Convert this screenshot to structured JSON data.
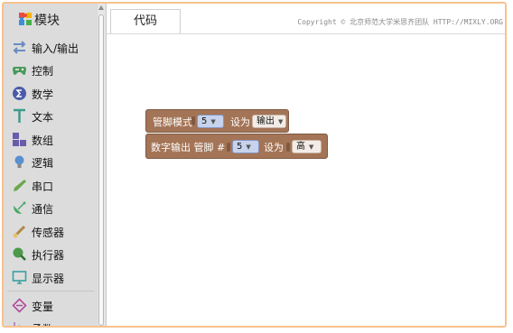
{
  "sidebar": {
    "header_title": "模块",
    "categories": [
      {
        "label": "输入/输出",
        "icon": "arrows-swap-icon",
        "color": "#6a8bbf"
      },
      {
        "label": "控制",
        "icon": "gamepad-icon",
        "color": "#4a9a5a"
      },
      {
        "label": "数学",
        "icon": "sigma-icon",
        "color": "#4a5ba8"
      },
      {
        "label": "文本",
        "icon": "letter-t-icon",
        "color": "#3f9a8c"
      },
      {
        "label": "数组",
        "icon": "grid-blocks-icon",
        "color": "#6a5bab"
      },
      {
        "label": "逻辑",
        "icon": "bulb-icon",
        "color": "#5a8fd0"
      },
      {
        "label": "串口",
        "icon": "pen-icon",
        "color": "#6aa84a"
      },
      {
        "label": "通信",
        "icon": "satellite-icon",
        "color": "#4aa86a"
      },
      {
        "label": "传感器",
        "icon": "sensor-icon",
        "color": "#b08a4a"
      },
      {
        "label": "执行器",
        "icon": "actuator-icon",
        "color": "#4a9a4a"
      },
      {
        "label": "显示器",
        "icon": "monitor-icon",
        "color": "#3aa0a0"
      },
      {
        "label": "变量",
        "icon": "variable-icon",
        "color": "#b04a9a"
      },
      {
        "label": "函数",
        "icon": "function-icon",
        "color": "#9a6aba"
      }
    ]
  },
  "tabs": [
    {
      "label": "代码"
    }
  ],
  "copyright": "Copyright © 北京师范大学米思齐团队 HTTP://MIXLY.ORG",
  "blocks": {
    "pin_mode": {
      "label": "管脚模式",
      "pin": "5",
      "set_label": "设为",
      "mode": "输出"
    },
    "digital_write": {
      "label": "数字输出 管脚 #",
      "pin": "5",
      "set_label": "设为",
      "level": "高"
    }
  },
  "colors": {
    "frame": "#f7c28e",
    "block": "#a47456"
  }
}
